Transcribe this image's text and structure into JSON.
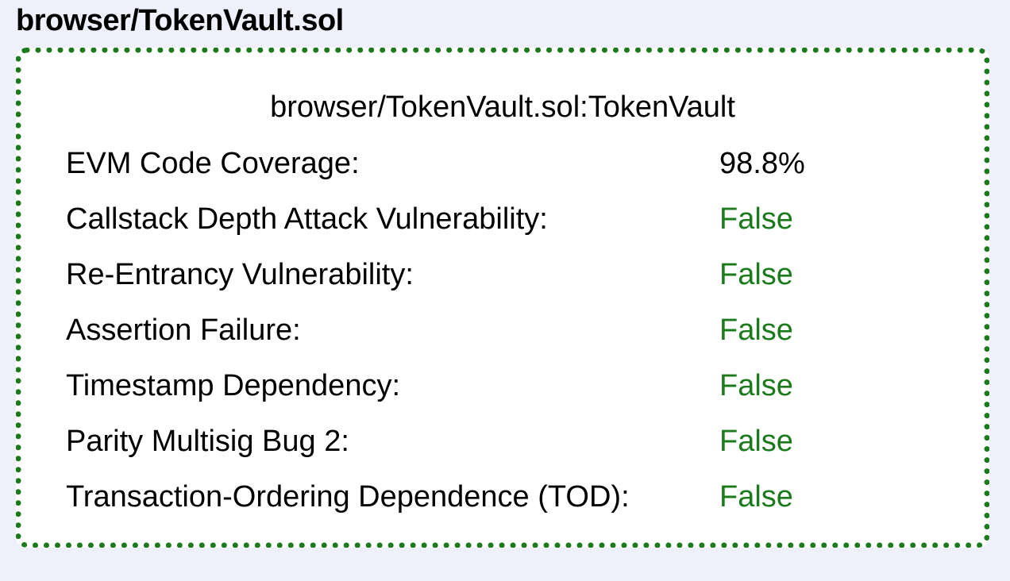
{
  "header": {
    "file_name": "browser/TokenVault.sol"
  },
  "report": {
    "contract_title": "browser/TokenVault.sol:TokenVault",
    "rows": [
      {
        "label": "EVM Code Coverage:",
        "value": "98.8%"
      },
      {
        "label": "Callstack Depth Attack Vulnerability:",
        "value": "False"
      },
      {
        "label": "Re-Entrancy Vulnerability:",
        "value": "False"
      },
      {
        "label": "Assertion Failure:",
        "value": "False"
      },
      {
        "label": "Timestamp Dependency:",
        "value": "False"
      },
      {
        "label": "Parity Multisig Bug 2:",
        "value": "False"
      },
      {
        "label": "Transaction-Ordering Dependence (TOD):",
        "value": "False"
      }
    ]
  },
  "colors": {
    "background": "#eef0fb",
    "card_border": "#1b7a1b",
    "safe_value": "#1b7a1b"
  }
}
